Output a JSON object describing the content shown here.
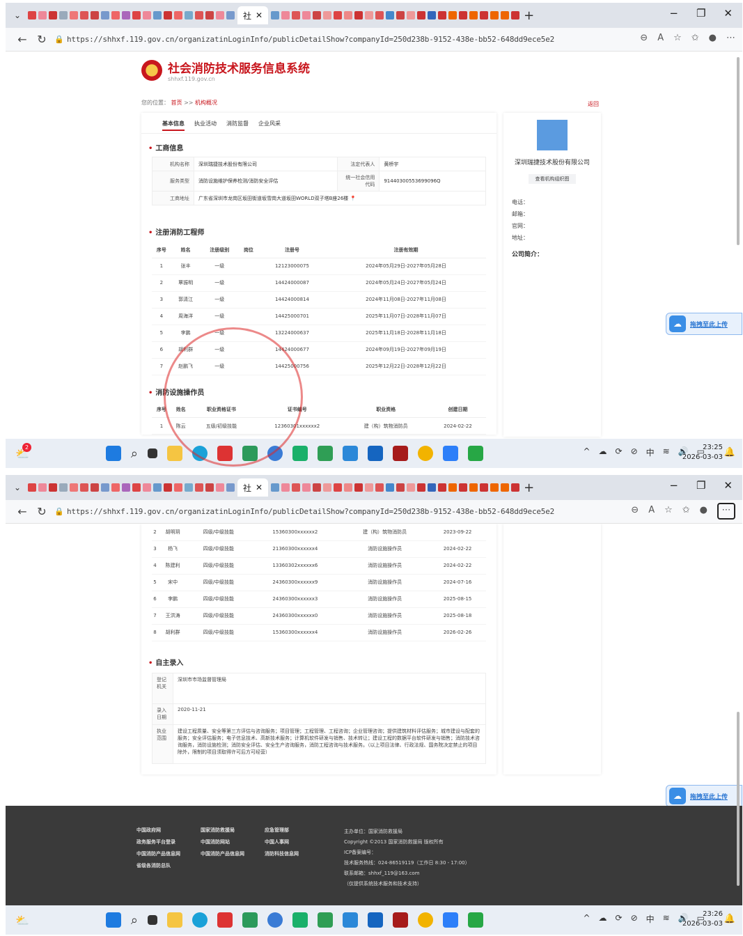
{
  "browser": {
    "active_tab_label": "社",
    "url": "https://shhxf.119.gov.cn/organizatinLoginInfo/publicDetailShow?companyId=250d238b-9152-438e-bb52-648dd9ece5e2"
  },
  "site": {
    "title": "社会消防技术服务信息系统",
    "subtitle": "shhxf.119.gov.cn"
  },
  "breadcrumb": {
    "prefix": "您的位置：",
    "home": "首页",
    "sep": ">>",
    "current": "机构概况"
  },
  "back_label": "返回",
  "tabs": [
    "基本信息",
    "执业活动",
    "消防监督",
    "企业风采"
  ],
  "business": {
    "title": "工商信息",
    "name_label": "机构名称",
    "name": "深圳瑞捷技术股份有限公司",
    "legal_label": "法定代表人",
    "legal": "黄桥宇",
    "service_label": "服务类型",
    "service": "消防设施维护保养检测/消防安全评估",
    "credit_label": "统一社会信用代码",
    "credit": "91440300553699096Q",
    "address_label": "工商地址",
    "address": "广东省深圳市龙岗区坂田街道坂雪岗大道坂田WORLD双子塔B座26楼"
  },
  "engineers": {
    "title": "注册消防工程师",
    "headers": [
      "序号",
      "姓名",
      "注册级别",
      "岗位",
      "注册号",
      "注册有效期"
    ],
    "rows": [
      [
        "1",
        "张丰",
        "一级",
        "",
        "12123000075",
        "2024年05月29日-2027年05月28日"
      ],
      [
        "2",
        "覃振明",
        "一级",
        "",
        "14424000087",
        "2024年05月24日-2027年05月24日"
      ],
      [
        "3",
        "郭清江",
        "一级",
        "",
        "14424000814",
        "2024年11月08日-2027年11月08日"
      ],
      [
        "4",
        "周海洋",
        "一级",
        "",
        "14425000701",
        "2025年11月07日-2028年11月07日"
      ],
      [
        "5",
        "李鹏",
        "一级",
        "",
        "13224000637",
        "2025年11月18日-2028年11月18日"
      ],
      [
        "6",
        "胡利群",
        "一级",
        "",
        "14424000677",
        "2024年09月19日-2027年09月19日"
      ],
      [
        "7",
        "赵鹏飞",
        "一级",
        "",
        "14425000756",
        "2025年12月22日-2028年12月22日"
      ]
    ]
  },
  "operators": {
    "title": "消防设施操作员",
    "headers": [
      "序号",
      "姓名",
      "职业资格证书",
      "证书编号",
      "职业资格",
      "创建日期"
    ],
    "rows": [
      [
        "1",
        "陈云",
        "五级/初级技能",
        "12360301xxxxxx2",
        "建（构）筑物消防员",
        "2024-02-22"
      ],
      [
        "2",
        "胡明玥",
        "四级/中级技能",
        "15360300xxxxxx2",
        "建（构）筑物消防员",
        "2023-09-22"
      ],
      [
        "3",
        "杨飞",
        "四级/中级技能",
        "21360300xxxxxx4",
        "消防设施操作员",
        "2024-02-22"
      ],
      [
        "4",
        "陈建利",
        "四级/中级技能",
        "13360302xxxxxx6",
        "消防设施操作员",
        "2024-02-22"
      ],
      [
        "5",
        "宋中",
        "四级/中级技能",
        "24360300xxxxxx9",
        "消防设施操作员",
        "2024-07-16"
      ],
      [
        "6",
        "李鹏",
        "四级/中级技能",
        "24360300xxxxxx3",
        "消防设施操作员",
        "2025-08-15"
      ],
      [
        "7",
        "王洪涛",
        "四级/中级技能",
        "24360300xxxxxx0",
        "消防设施操作员",
        "2025-08-18"
      ],
      [
        "8",
        "胡利群",
        "四级/中级技能",
        "15360300xxxxxx4",
        "消防设施操作员",
        "2026-02-26"
      ]
    ]
  },
  "self_entry": {
    "title": "自主录入",
    "reg_label": "登记机关",
    "reg_value": "深圳市市场监督管理局",
    "date_label": "录入日期",
    "date_value": "2020-11-21",
    "scope_label": "执业范围",
    "scope_value": "建设工程质量、安全等第三方评估与咨询服务；项目管理；工程管理、工程咨询；企业管理咨询；提供建筑材料评估服务；城市建设与配套的服务；安全评估服务；电子信息技术、高新技术服务；计算机软件研发与销售、技术转让；建设工程的数据平台软件研发与销售；消防技术咨询服务，消防设施检测；消防安全评估、安全生产咨询服务，消防工程咨询与技术服务。（以上项目法律、行政法规、国务院决定禁止的项目除外，限制的项目须取得许可后方可经营）"
  },
  "side": {
    "company": "深圳瑞捷技术股份有限公司",
    "button": "查看机构组织图",
    "contacts": [
      "电话：",
      "邮箱：",
      "官网：",
      "地址："
    ],
    "intro": "公司简介："
  },
  "upload_widget": "拖拽至此上传",
  "footer": {
    "links": [
      "中国政府网",
      "国家消防救援局",
      "应急管理部",
      "政务服务平台登录",
      "中国消防网站",
      "中国人事网",
      "中国消防产品信息网",
      "中国消防产品信息网",
      "消防科技信息网",
      "省级各消防总队"
    ],
    "info": [
      "主办单位：国家消防救援局",
      "Copyright ©2013 国家消防救援局 版权所有",
      "ICP备案编号：",
      "技术服务热线：024-86519119（工作日 8:30 - 17:00）",
      "联系邮箱：shhxf_119@163.com",
      "（仅提供系统技术服务和技术支持）"
    ]
  },
  "taskbar": {
    "weather_badge": "2",
    "input_method": "中",
    "clock1_time": "23:25",
    "clock2_time": "23:26",
    "clock_date": "2026-03-03"
  },
  "colors": {
    "brand_red": "#c8161d",
    "upload_blue": "#3a8ee6",
    "footer_bg": "#3a3a3a"
  }
}
